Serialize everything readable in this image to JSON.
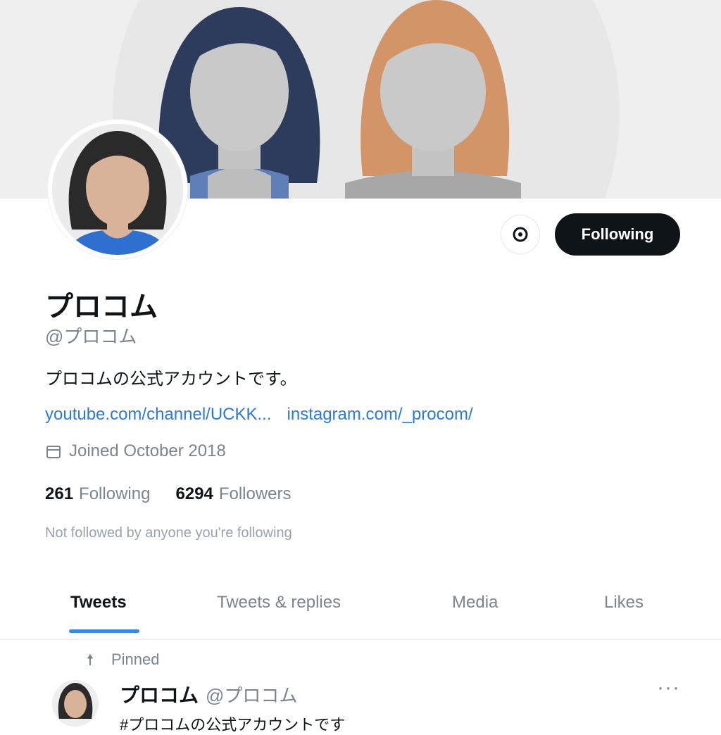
{
  "profile": {
    "name": "プロコム",
    "handle": "@プロコム",
    "bio": "プロコムの公式アカウントです。",
    "links": [
      "youtube.com/channel/UCKK...",
      "instagram.com/_procom/"
    ],
    "joined": "Joined October 2018",
    "following_count": "261",
    "following_label": "Following",
    "followers_count": "6294",
    "followers_label": "Followers",
    "followed_note": "Not followed by anyone you're following"
  },
  "actions": {
    "follow_label": "Following",
    "notify_icon": "bell-icon"
  },
  "tabs": [
    "Tweets",
    "Tweets & replies",
    "Media",
    "Likes"
  ],
  "active_tab": "Tweets",
  "pinned": {
    "label": "Pinned",
    "author": "プロコム",
    "handle": "@プロコム",
    "text": "#プロコムの公式アカウントです",
    "more_icon": "more-icon"
  },
  "colors": {
    "accent": "#3a8be0",
    "link": "#2b7bd6",
    "button": "#0f1419",
    "muted": "#7a8590"
  }
}
